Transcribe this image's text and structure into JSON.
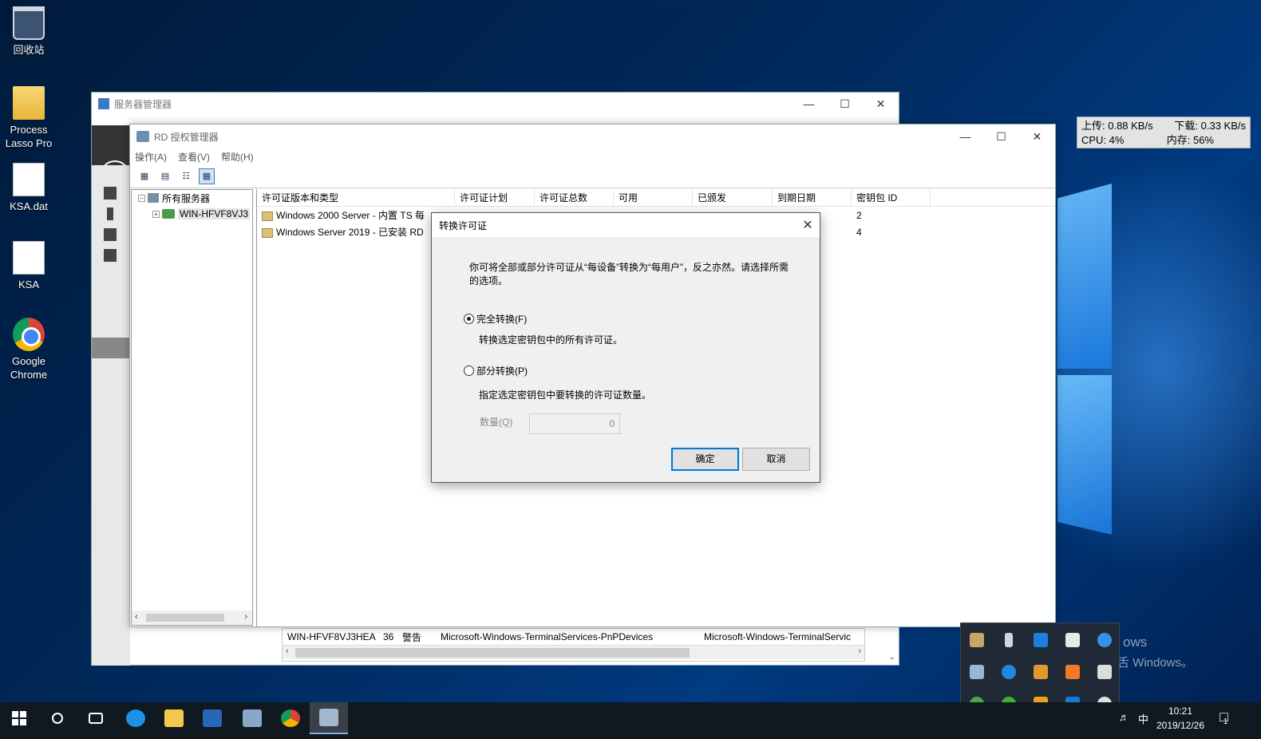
{
  "desktop": {
    "icons": [
      {
        "label": "回收站"
      },
      {
        "label": "Process Lasso Pro"
      },
      {
        "label": "KSA.dat"
      },
      {
        "label": "KSA"
      },
      {
        "label": "Google Chrome"
      }
    ],
    "watermark_line1": "ows",
    "watermark_line2": "舌 Windows。"
  },
  "server_manager": {
    "title": "服务器管理器",
    "event_row": {
      "server": "WIN-HFVF8VJ3HEA",
      "id": "36",
      "level": "警告",
      "source": "Microsoft-Windows-TerminalServices-PnPDevices",
      "log": "Microsoft-Windows-TerminalServic"
    }
  },
  "rd_manager": {
    "title": "RD 授权管理器",
    "menu": [
      "操作(A)",
      "查看(V)",
      "帮助(H)"
    ],
    "tree": {
      "root": "所有服务器",
      "server": "WIN-HFVF8VJ3"
    },
    "columns": [
      "许可证版本和类型",
      "许可证计划",
      "许可证总数",
      "可用",
      "已颁发",
      "到期日期",
      "密钥包 ID"
    ],
    "rows": [
      {
        "name": "Windows 2000 Server - 内置 TS 每",
        "key_id": "2"
      },
      {
        "name": "Windows Server 2019 -  已安装 RD",
        "key_id": "4"
      }
    ]
  },
  "dialog": {
    "title": "转换许可证",
    "description": "你可将全部或部分许可证从“每设备”转换为“每用户”，反之亦然。请选择所需的选项。",
    "option_full": "完全转换(F)",
    "option_full_desc": "转换选定密钥包中的所有许可证。",
    "option_partial": "部分转换(P)",
    "option_partial_desc": "指定选定密钥包中要转换的许可证数量。",
    "quantity_label": "数量(Q)",
    "quantity_value": "0",
    "ok": "确定",
    "cancel": "取消",
    "selected_option": "full"
  },
  "netspeed": {
    "upload": "上传: 0.88 KB/s",
    "download": "下载: 0.33 KB/s",
    "cpu": "CPU: 4%",
    "memory": "内存: 56%"
  },
  "taskbar": {
    "time": "10:21",
    "date": "2019/12/26",
    "ime": "中",
    "notification_count": "1"
  },
  "colors": {
    "accent": "#0078d7",
    "taskbar": "#101820",
    "sm_header": "#353535"
  }
}
